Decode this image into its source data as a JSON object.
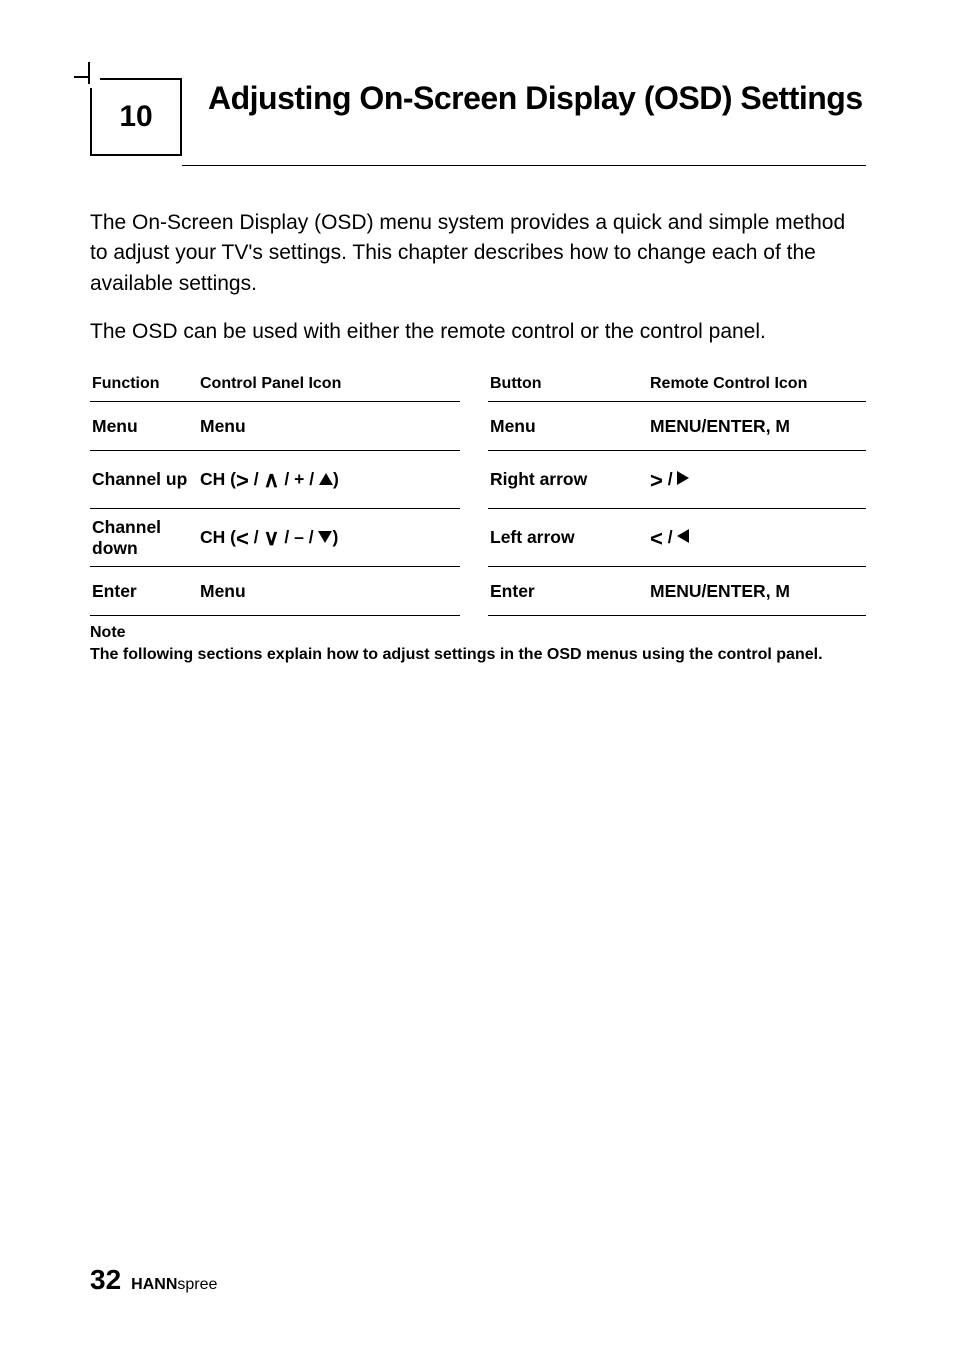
{
  "chapter": {
    "number": "10",
    "title": "Adjusting On-Screen Display (OSD) Settings"
  },
  "intro": {
    "p1": "The On-Screen Display (OSD) menu system provides a quick and simple method to adjust your TV's settings. This chapter describes how to change each of the available settings.",
    "p2": "The OSD can be used with either the remote control or the control panel."
  },
  "table_headers": {
    "function": "Function",
    "control_panel_icon": "Control Panel Icon",
    "button": "Button",
    "remote_control_icon": "Remote Control Icon"
  },
  "rows": {
    "menu": {
      "function": "Menu",
      "cp_icon": "Menu",
      "button": "Menu",
      "rc_icon": "MENU/ENTER, M"
    },
    "channel_up": {
      "function": "Channel up",
      "cp_prefix": "CH (",
      "cp_suffix": ")",
      "button": "Right arrow"
    },
    "channel_down": {
      "function": "Channel down",
      "cp_prefix": "CH (",
      "cp_suffix": ")",
      "button": "Left arrow"
    },
    "enter": {
      "function": "Enter",
      "cp_icon": "Menu",
      "button": "Enter",
      "rc_icon": "MENU/ENTER, M"
    }
  },
  "note": {
    "label": "Note",
    "text": "The following sections explain how to adjust settings in the OSD menus using the control panel."
  },
  "footer": {
    "page": "32",
    "brand_bold": "HANN",
    "brand_light": "spree"
  }
}
